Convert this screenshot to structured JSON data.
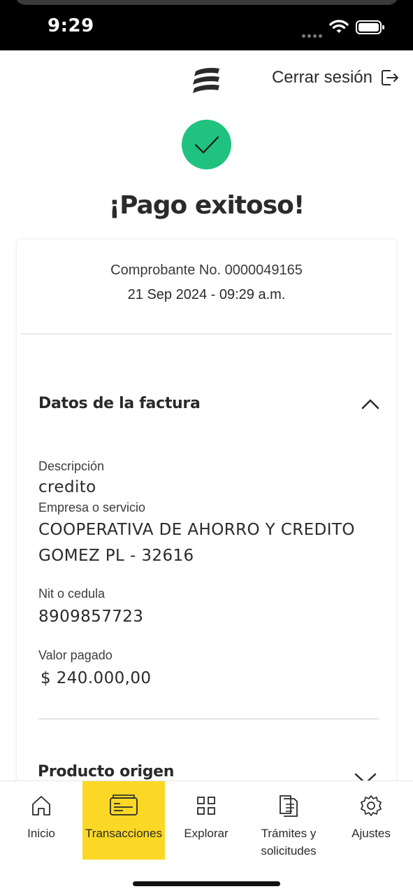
{
  "status_bar": {
    "time": "9:29"
  },
  "header": {
    "logout_label": "Cerrar sesión"
  },
  "success": {
    "title": "¡Pago exitoso!"
  },
  "receipt": {
    "number_text": "Comprobante No. 0000049165",
    "datetime": "21 Sep 2024 - 09:29 a.m."
  },
  "invoice_section": {
    "title": "Datos de la factura",
    "fields": [
      {
        "label": "Descripción",
        "value": "credito"
      },
      {
        "label": "Empresa o servicio",
        "value_line1": "COOPERATIVA DE AHORRO Y CREDITO",
        "value_line2": "GOMEZ PL - 32616"
      },
      {
        "label": "Nit o cedula",
        "value": "8909857723"
      },
      {
        "label": "Valor pagado",
        "value": "$ 240.000,00"
      }
    ]
  },
  "product_section": {
    "title": "Producto origen"
  },
  "nav": {
    "items": [
      {
        "label": "Inicio",
        "icon": "home-icon"
      },
      {
        "label": "Transacciones",
        "icon": "card-icon",
        "active": true
      },
      {
        "label": "Explorar",
        "icon": "grid-icon"
      },
      {
        "label_line1": "Trámites y",
        "label_line2": "solicitudes",
        "icon": "documents-icon"
      },
      {
        "label": "Ajustes",
        "icon": "gear-icon"
      }
    ]
  },
  "colors": {
    "accent_yellow": "#fcd826",
    "success_green": "#1fc27f"
  }
}
